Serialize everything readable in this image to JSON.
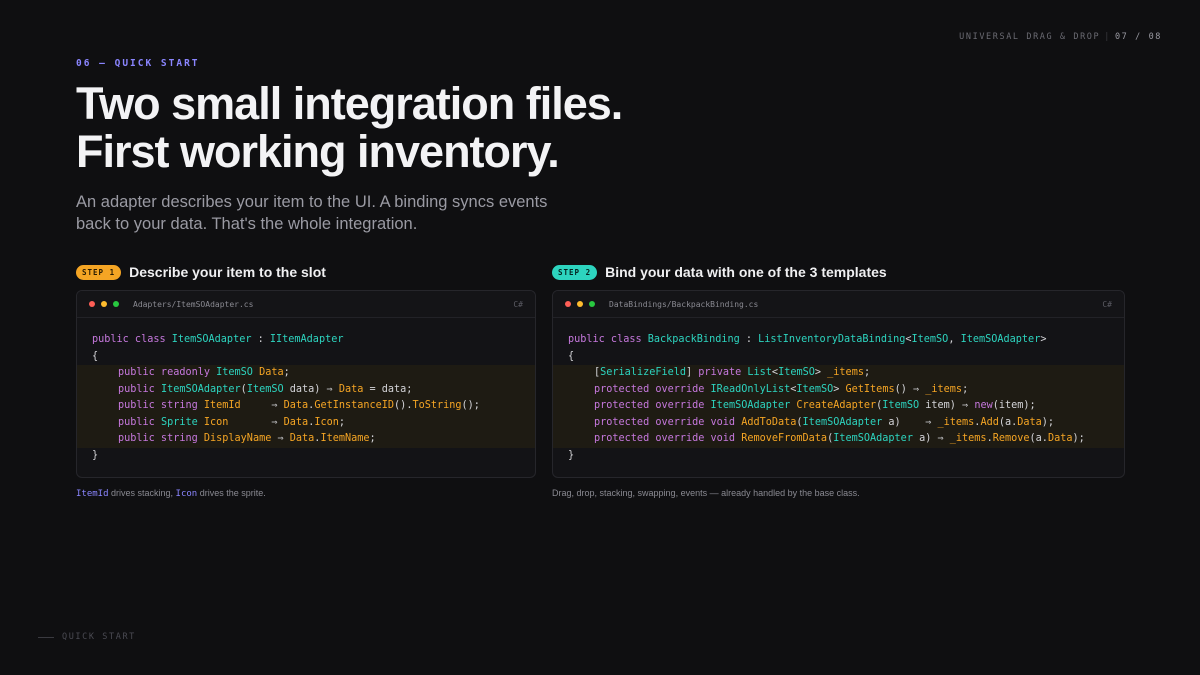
{
  "header": {
    "deck_title": "UNIVERSAL DRAG & DROP",
    "page_current": "07",
    "page_total": "08"
  },
  "eyebrow": "06 — QUICK START",
  "headline": {
    "line1": "Two small integration files.",
    "line2": "First working inventory."
  },
  "lede": {
    "line1": "An adapter describes your item to the UI. A binding syncs events",
    "line2": "back to your data. That's the whole integration."
  },
  "steps": [
    {
      "badge": "STEP 1",
      "title": "Describe your item to the slot",
      "file_path": "Adapters/ItemSOAdapter.cs",
      "language": "C#",
      "caption": {
        "term1": "ItemId",
        "text1": " drives stacking, ",
        "term2": "Icon",
        "text2": " drives the sprite."
      }
    },
    {
      "badge": "STEP 2",
      "title": "Bind your data with one of the 3 templates",
      "file_path": "DataBindings/BackpackBinding.cs",
      "language": "C#",
      "caption": {
        "text": "Drag, drop, stacking, swapping, events — already handled by the base class."
      }
    }
  ],
  "footer": {
    "label": "QUICK START"
  },
  "colors": {
    "background": "#0f0f11",
    "accent_purple": "#8a85ff",
    "accent_orange": "#f5a524",
    "accent_teal": "#2dd4bf",
    "keyword": "#c678dd"
  }
}
